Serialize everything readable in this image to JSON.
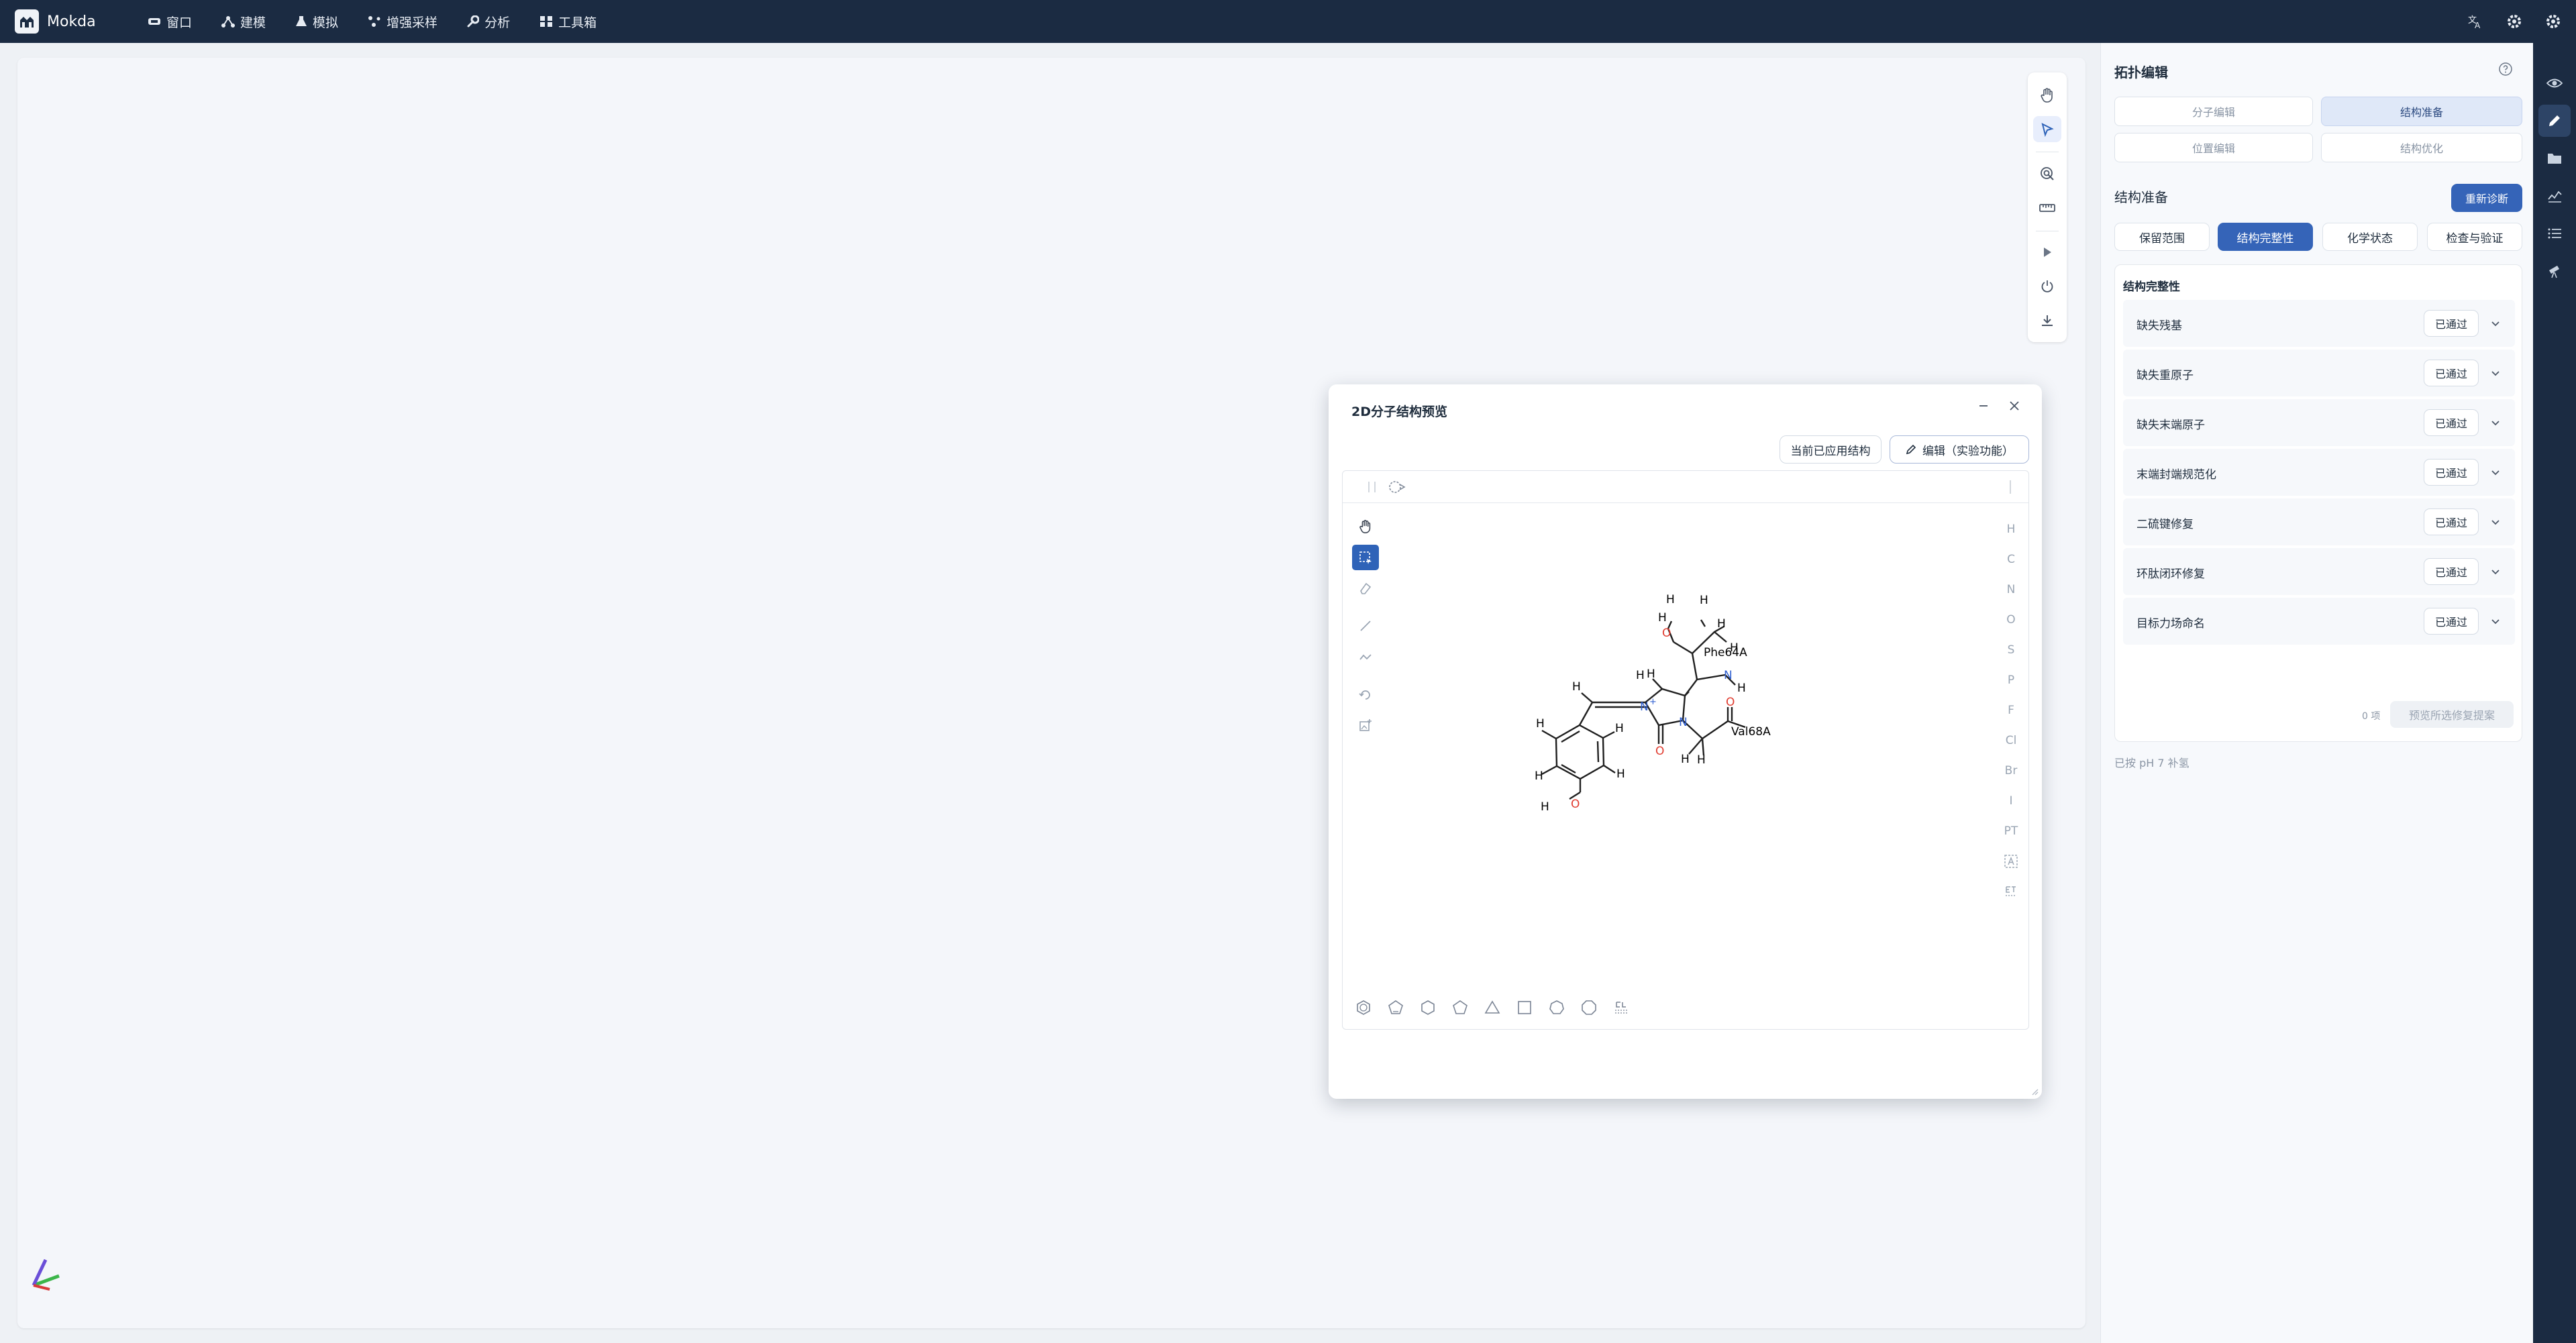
{
  "app": {
    "name": "Mokda"
  },
  "menu": [
    {
      "label": "窗口",
      "icon": "window-icon"
    },
    {
      "label": "建模",
      "icon": "build-icon"
    },
    {
      "label": "模拟",
      "icon": "flask-icon"
    },
    {
      "label": "增强采样",
      "icon": "sampling-icon"
    },
    {
      "label": "分析",
      "icon": "wrench-icon"
    },
    {
      "label": "工具箱",
      "icon": "toolbox-icon"
    }
  ],
  "viewer_tools": [
    "hand-icon",
    "pointer-icon",
    "target-select-icon",
    "ruler-icon",
    "play-icon",
    "power-icon",
    "download-icon"
  ],
  "dialog": {
    "title": "2D分子结构预览",
    "btn_applied": "当前已应用结构",
    "btn_edit": "编辑（实验功能）",
    "atoms": [
      "H",
      "C",
      "N",
      "O",
      "S",
      "P",
      "F",
      "Cl",
      "Br",
      "I",
      "PT"
    ],
    "molecule": {
      "labels": [
        "H",
        "H",
        "H",
        "H",
        "H",
        "H",
        "H",
        "H",
        "H",
        "H",
        "H",
        "H",
        "H",
        "H",
        "H",
        "H",
        "O",
        "O",
        "O",
        "O",
        "N",
        "N",
        "N"
      ],
      "charge": "+",
      "res1": "Phe64A",
      "res2": "Val68A"
    }
  },
  "panel": {
    "title": "拓扑编辑",
    "tabs": [
      "分子编辑",
      "结构准备",
      "位置编辑",
      "结构优化"
    ],
    "active_tab": "结构准备",
    "section_title": "结构准备",
    "rediagnose": "重新诊断",
    "subtabs": [
      "保留范围",
      "结构完整性",
      "化学状态",
      "检查与验证"
    ],
    "active_subtab": "结构完整性",
    "card_title": "结构完整性",
    "checks": [
      {
        "label": "缺失残基",
        "status": "已通过"
      },
      {
        "label": "缺失重原子",
        "status": "已通过"
      },
      {
        "label": "缺失末端原子",
        "status": "已通过"
      },
      {
        "label": "末端封端规范化",
        "status": "已通过"
      },
      {
        "label": "二硫键修复",
        "status": "已通过"
      },
      {
        "label": "环肽闭环修复",
        "status": "已通过"
      },
      {
        "label": "目标力场命名",
        "status": "已通过"
      }
    ],
    "count_text": "0 项",
    "preview_btn": "预览所选修复提案",
    "note": "已按 pH 7 补氢"
  },
  "colors": {
    "topbar": "#1b2b42",
    "accent": "#3564b8",
    "oxygen": "#e03a2e",
    "nitrogen": "#2f5fd0"
  }
}
